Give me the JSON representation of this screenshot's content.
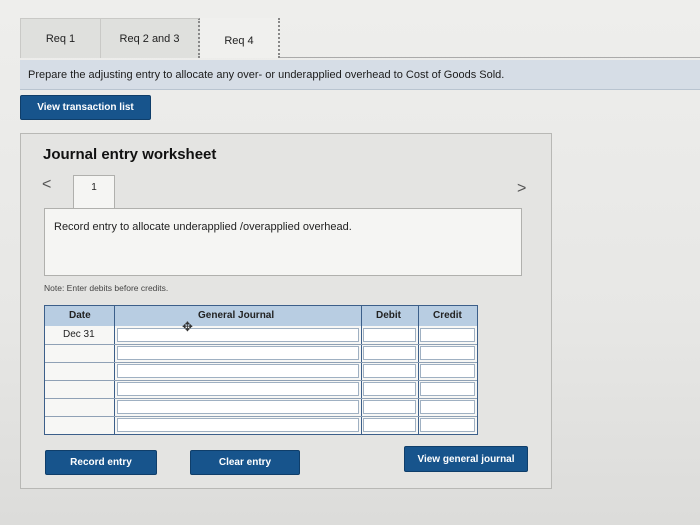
{
  "tabs": {
    "req1": "Req 1",
    "req2and3": "Req 2 and 3",
    "req4": "Req 4"
  },
  "instruction": "Prepare the adjusting entry to allocate any over- or underapplied overhead to Cost of Goods Sold.",
  "buttons": {
    "view_transaction_list": "View transaction list",
    "record_entry": "Record entry",
    "clear_entry": "Clear entry",
    "view_general_journal": "View general journal"
  },
  "worksheet": {
    "title": "Journal entry worksheet",
    "page_number": "1",
    "nav_prev": "<",
    "nav_next": ">",
    "entry_description": "Record entry to allocate underapplied /overapplied overhead.",
    "note": "Note: Enter debits before credits."
  },
  "table": {
    "headers": {
      "date": "Date",
      "general_journal": "General Journal",
      "debit": "Debit",
      "credit": "Credit"
    },
    "rows": [
      {
        "date": "Dec 31",
        "account": "",
        "debit": "",
        "credit": ""
      },
      {
        "date": "",
        "account": "",
        "debit": "",
        "credit": ""
      },
      {
        "date": "",
        "account": "",
        "debit": "",
        "credit": ""
      },
      {
        "date": "",
        "account": "",
        "debit": "",
        "credit": ""
      },
      {
        "date": "",
        "account": "",
        "debit": "",
        "credit": ""
      },
      {
        "date": "",
        "account": "",
        "debit": "",
        "credit": ""
      }
    ]
  },
  "colors": {
    "button_blue": "#17548c",
    "header_blue": "#b8cde2",
    "instruction_bar": "#d6dde6"
  }
}
